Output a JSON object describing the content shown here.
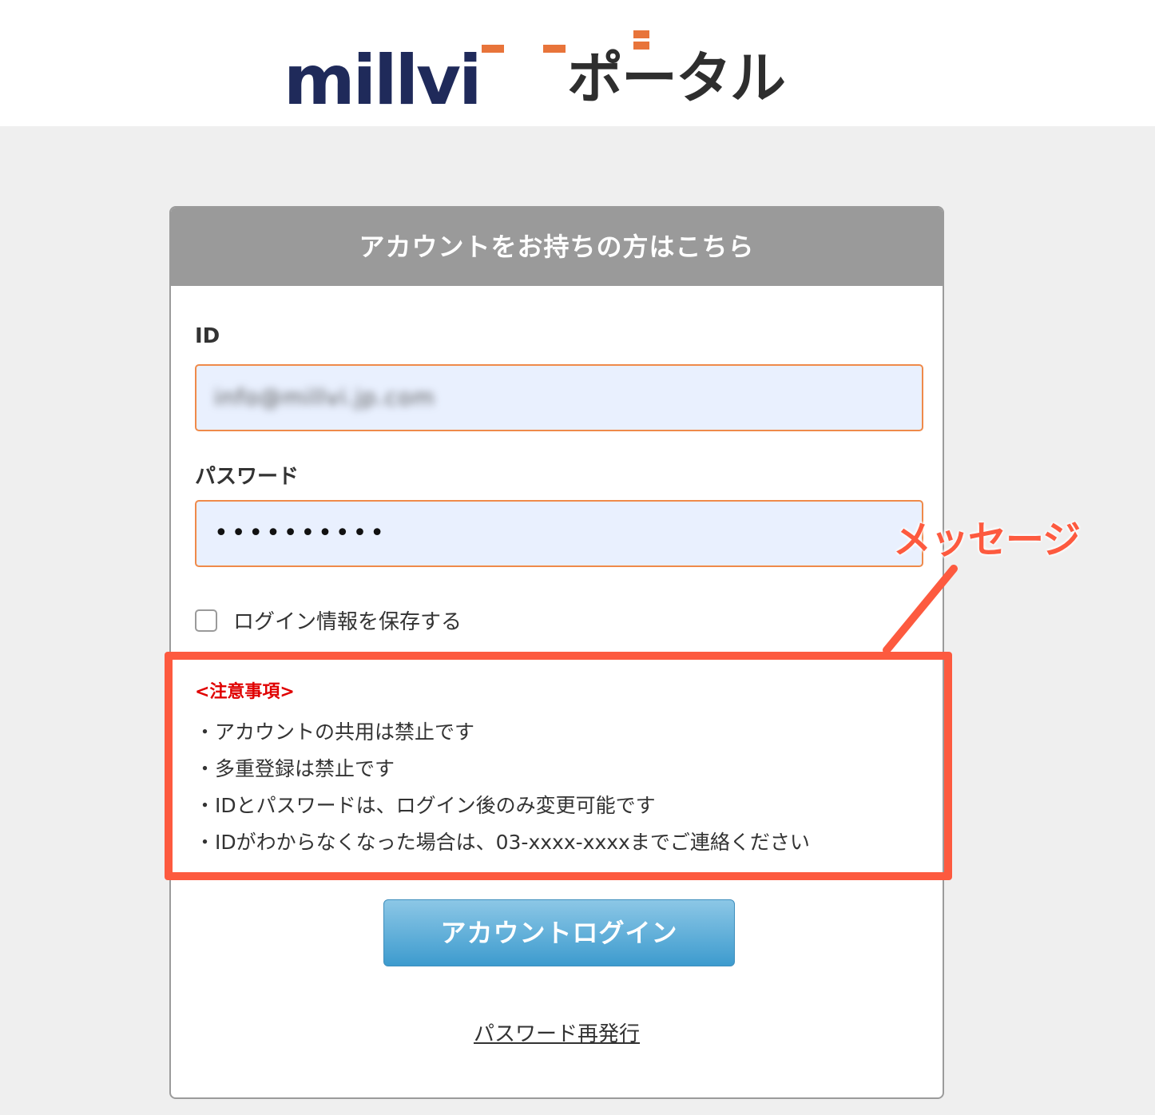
{
  "logo": {
    "word": "millvi",
    "kana": "ポータル"
  },
  "card": {
    "title": "アカウントをお持ちの方はこちら",
    "id_label": "ID",
    "id_value": "info@millvi.jp.com",
    "password_label": "パスワード",
    "password_value": "••••••••••",
    "remember_label": "ログイン情報を保存する",
    "notes_title": "<注意事項>",
    "notes": [
      "・アカウントの共用は禁止です",
      "・多重登録は禁止です",
      "・IDとパスワードは、ログイン後のみ変更可能です",
      "・IDがわからなくなった場合は、03-xxxx-xxxxまでご連絡ください"
    ],
    "login_button": "アカウントログイン",
    "reissue_link": "パスワード再発行"
  },
  "annotation": {
    "label": "メッセージ",
    "color": "#fd5a3f"
  },
  "colors": {
    "header_bg": "#9a9a9a",
    "input_border": "#ef8a4a",
    "input_bg": "#e9f0fe",
    "button": "#3d9bce",
    "warning": "#e00000"
  }
}
